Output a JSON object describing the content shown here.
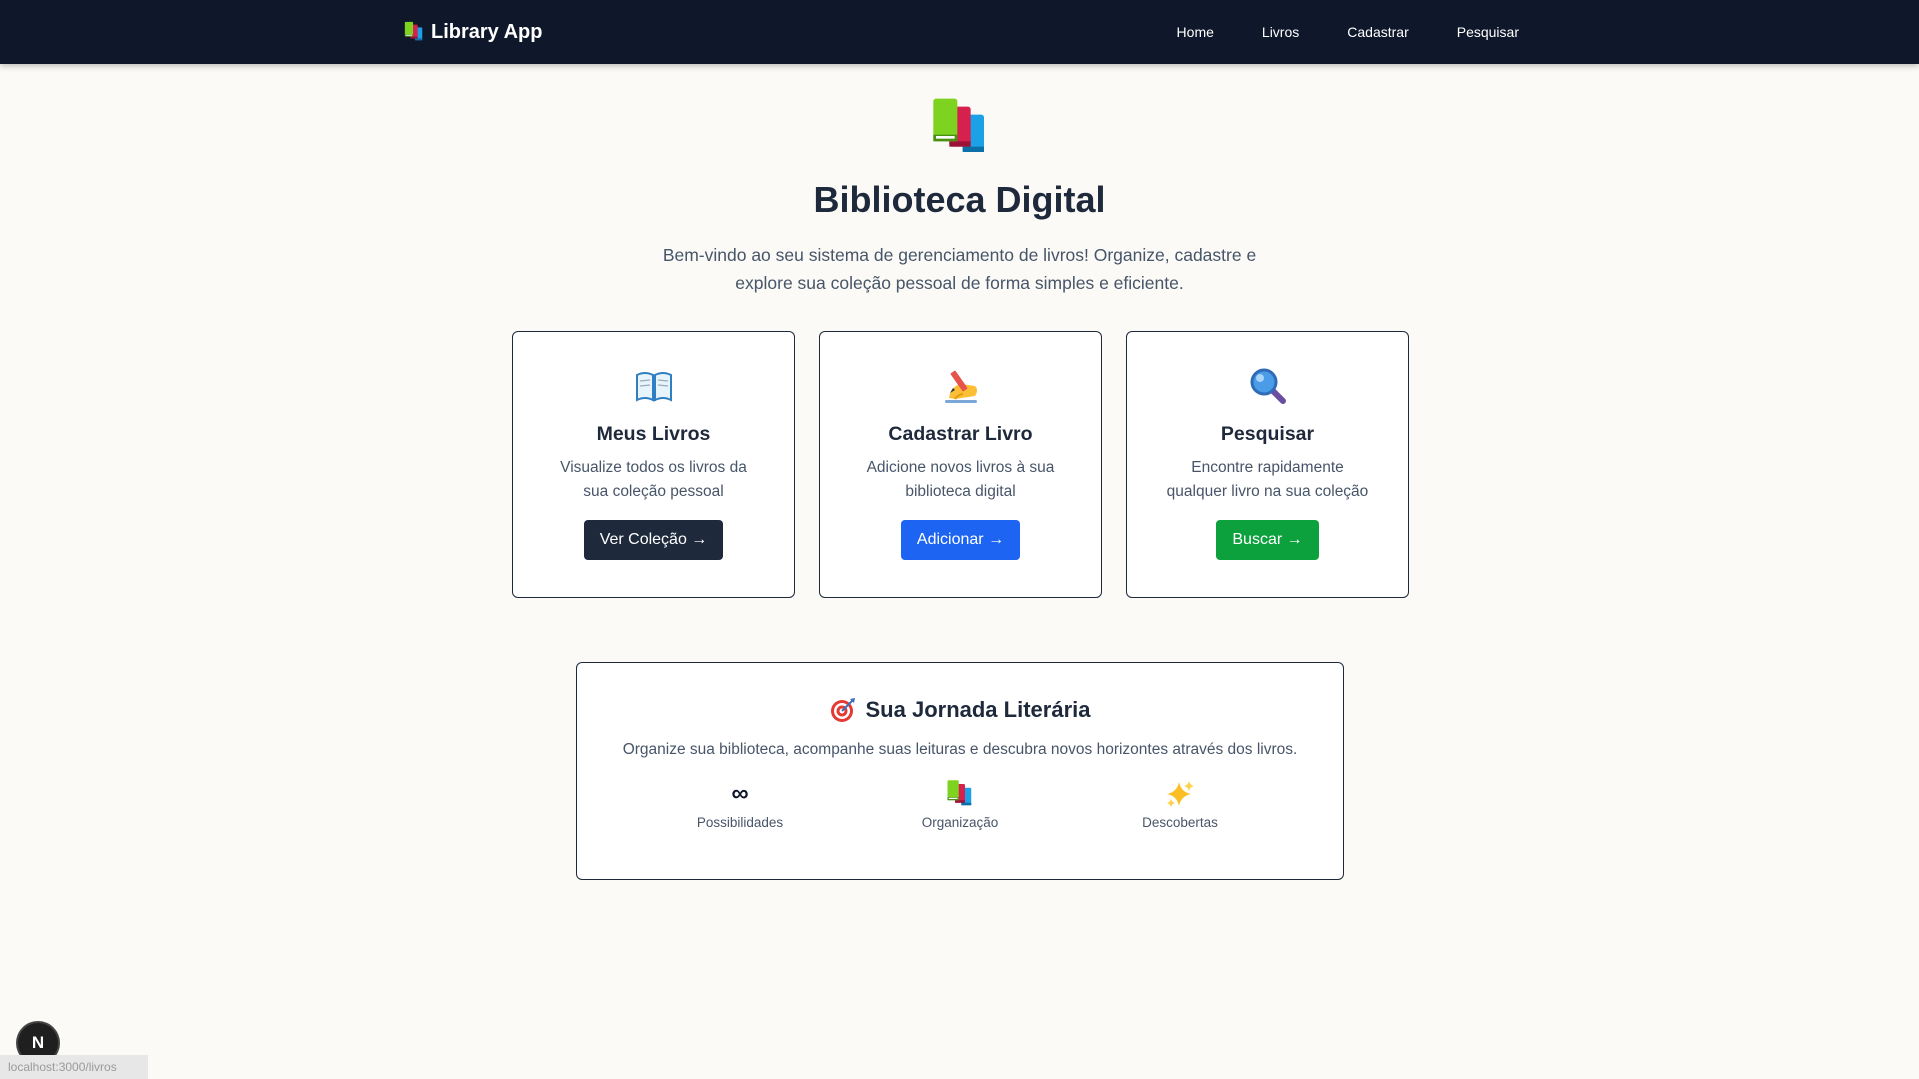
{
  "nav": {
    "brand_icon": "books-icon",
    "brand": "Library App",
    "links": [
      "Home",
      "Livros",
      "Cadastrar",
      "Pesquisar"
    ]
  },
  "hero": {
    "icon": "books-icon",
    "title": "Biblioteca Digital",
    "description": "Bem-vindo ao seu sistema de gerenciamento de livros! Organize, cadastre e explore sua coleção pessoal de forma simples e eficiente."
  },
  "cards": [
    {
      "icon": "open-book-icon",
      "title": "Meus Livros",
      "description": "Visualize todos os livros da sua coleção pessoal",
      "button": "Ver Coleção →",
      "button_color": "#1e293b"
    },
    {
      "icon": "writing-hand-icon",
      "title": "Cadastrar Livro",
      "description": "Adicione novos livros à sua biblioteca digital",
      "button": "Adicionar →",
      "button_color": "#1d64f2"
    },
    {
      "icon": "magnifier-icon",
      "title": "Pesquisar",
      "description": "Encontre rapidamente qualquer livro na sua coleção",
      "button": "Buscar →",
      "button_color": "#0da13e"
    }
  ],
  "journey": {
    "icon": "target-icon",
    "title": "Sua Jornada Literária",
    "description": "Organize sua biblioteca, acompanhe suas leituras e descubra novos horizontes através dos livros.",
    "stats": [
      {
        "icon": "∞",
        "label": "Possibilidades"
      },
      {
        "icon": "books-icon",
        "label": "Organização"
      },
      {
        "icon": "sparkles-icon",
        "label": "Descobertas"
      }
    ]
  },
  "dev_badge": "N",
  "status_url": "localhost:3000/livros"
}
